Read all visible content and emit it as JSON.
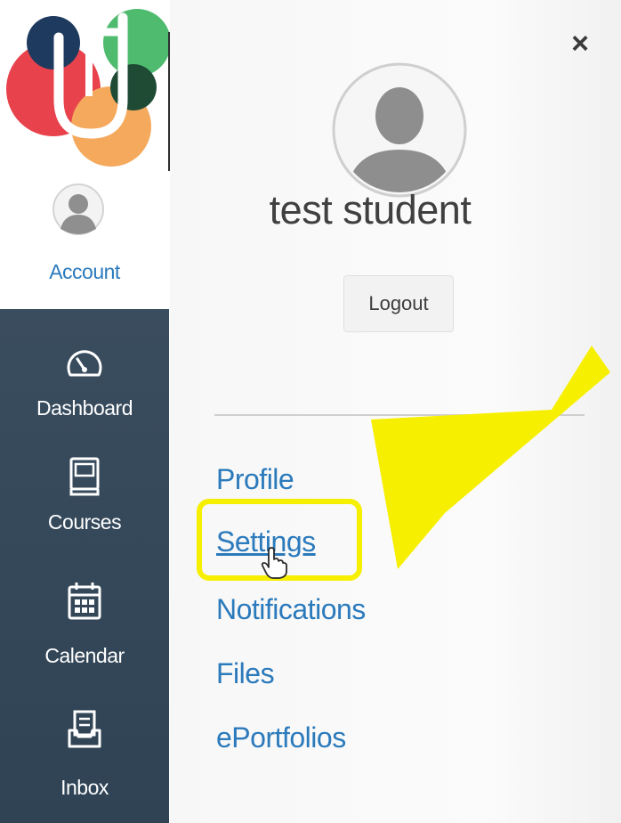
{
  "sidebar": {
    "account_label": "Account",
    "items": [
      {
        "label": "Dashboard",
        "icon": "dashboard-icon"
      },
      {
        "label": "Courses",
        "icon": "courses-icon"
      },
      {
        "label": "Calendar",
        "icon": "calendar-icon"
      },
      {
        "label": "Inbox",
        "icon": "inbox-icon"
      }
    ]
  },
  "tray": {
    "user_name": "test student",
    "logout_label": "Logout",
    "close_symbol": "×",
    "links": [
      {
        "label": "Profile"
      },
      {
        "label": "Settings"
      },
      {
        "label": "Notifications"
      },
      {
        "label": "Files"
      },
      {
        "label": "ePortfolios"
      }
    ]
  },
  "colors": {
    "nav_background": "#34495c",
    "link_blue": "#2b7abc",
    "highlight_yellow": "#f7ef00",
    "logo_red": "#e8424d",
    "logo_navy": "#1e3a5f",
    "logo_green": "#4fbb6f",
    "logo_orange": "#f5a95d"
  }
}
